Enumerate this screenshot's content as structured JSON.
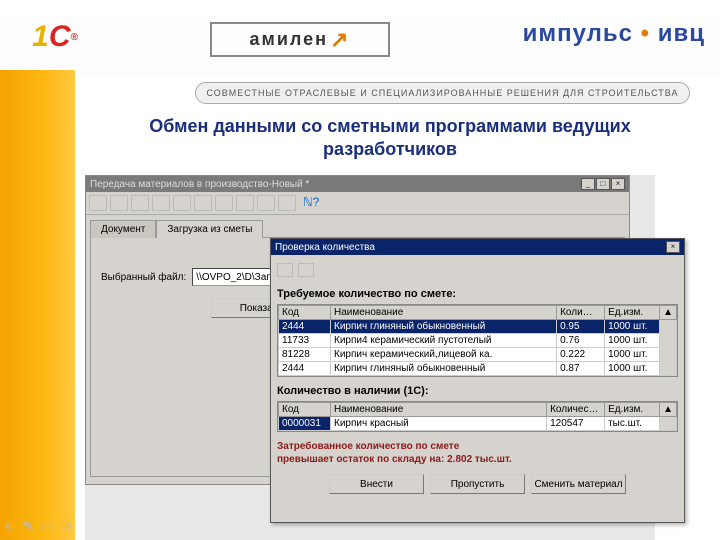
{
  "brand": {
    "logo1c_1": "1",
    "logo1c_c": "C",
    "amilen": "амилен",
    "impuls_a": "импульс",
    "impuls_b": "ивц",
    "tagline": "СОВМЕСТНЫЕ ОТРАСЛЕВЫЕ И СПЕЦИАЛИЗИРОВАННЫЕ РЕШЕНИЯ ДЛЯ СТРОИТЕЛЬСТВА"
  },
  "slide": {
    "title": "Обмен данными со сметными программами ведущих разработчиков"
  },
  "win1": {
    "title": "Передача материалов в производство-Новый *",
    "tabs": {
      "doc": "Документ",
      "load": "Загрузка из сметы"
    },
    "file_label": "Выбранный файл:",
    "file_value": "\\\\OVPO_2\\D\\Записи",
    "show_btn": "Показать"
  },
  "dlg": {
    "title": "Проверка количества",
    "section1": "Требуемое количество по смете:",
    "section2": "Количество в наличии (1С):",
    "cols": {
      "kod": "Код",
      "naim": "Наименование",
      "kol": "Коли…",
      "ed": "Ед.изм."
    },
    "cols2": {
      "kod": "Код",
      "naim": "Наименование",
      "kol": "Количес…",
      "ed": "Ед.изм."
    },
    "rows1": [
      {
        "kod": "2444",
        "naim": "Кирпич глиняный обыкновенный",
        "kol": "0.95",
        "ed": "1000 шт."
      },
      {
        "kod": "11733",
        "naim": "Кирпи4 керамический пустотелый",
        "kol": "0.76",
        "ed": "1000 шт."
      },
      {
        "kod": "81228",
        "naim": "Кирпич керамический,лицевой ка.",
        "kol": "0.222",
        "ed": "1000 шт."
      },
      {
        "kod": "2444",
        "naim": "Кирпич глиняный обыкновенный",
        "kol": "0.87",
        "ed": "1000 шт."
      }
    ],
    "rows2": [
      {
        "kod": "0000031",
        "naim": "Кирпич красный",
        "kol": "120547",
        "ed": "тыс.шт."
      }
    ],
    "warning_l1": "Затребованное количество по смете",
    "warning_l2": "превышает остаток по складу на: 2.802 тыс.шт.",
    "buttons": {
      "apply": "Внести",
      "skip": "Пропустить",
      "change": "Сменить материал"
    }
  }
}
